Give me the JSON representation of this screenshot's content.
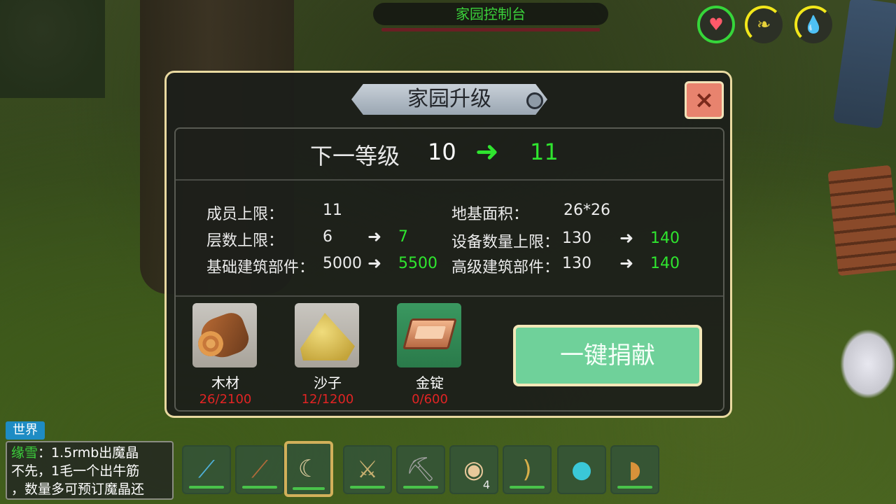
{
  "hud": {
    "control_title": "家园控制台"
  },
  "dialog": {
    "title": "家园升级",
    "close_label": "×",
    "level_label": "下一等级",
    "level_current": "10",
    "level_next": "11",
    "arrow": "➜",
    "stats": {
      "member_limit_label": "成员上限：",
      "member_limit_value": "11",
      "floor_limit_label": "层数上限：",
      "floor_limit_current": "6",
      "floor_limit_next": "7",
      "basic_parts_label": "基础建筑部件：",
      "basic_parts_current": "5000",
      "basic_parts_next": "5500",
      "foundation_area_label": "地基面积：",
      "foundation_area_value": "26*26",
      "device_limit_label": "设备数量上限：",
      "device_limit_current": "130",
      "device_limit_next": "140",
      "advanced_parts_label": "高级建筑部件：",
      "advanced_parts_current": "130",
      "advanced_parts_next": "140"
    },
    "resources": [
      {
        "name": "木材",
        "count": "26/2100",
        "icon": "wood-log-icon"
      },
      {
        "name": "沙子",
        "count": "12/1200",
        "icon": "sand-pile-icon"
      },
      {
        "name": "金锭",
        "count": "0/600",
        "icon": "gold-ingot-icon"
      }
    ],
    "donate_label": "一键捐献"
  },
  "chat": {
    "tab_label": "世界",
    "sender": "缘雪",
    "message_line1": "：1.5rmb出魔晶",
    "message_line2": "不先，1毛一个出牛筋",
    "message_line3": "，数量多可预订魔晶还"
  },
  "hotbar": {
    "slots": [
      {
        "icon": "crystal-spear-icon"
      },
      {
        "icon": "wooden-club-icon"
      },
      {
        "icon": "curved-blade-icon",
        "selected": true
      },
      {
        "icon": "battle-axe-icon"
      },
      {
        "icon": "pickaxe-icon"
      },
      {
        "icon": "steamed-buns-icon",
        "count": "4"
      },
      {
        "icon": "bow-icon"
      },
      {
        "icon": "dark-orb-icon"
      },
      {
        "icon": "water-pouch-icon"
      }
    ]
  },
  "colors": {
    "accent_green": "#2fe52f",
    "warning_red": "#e12424",
    "dialog_border": "#e9d9a0",
    "donate_button": "#6fd19a"
  }
}
